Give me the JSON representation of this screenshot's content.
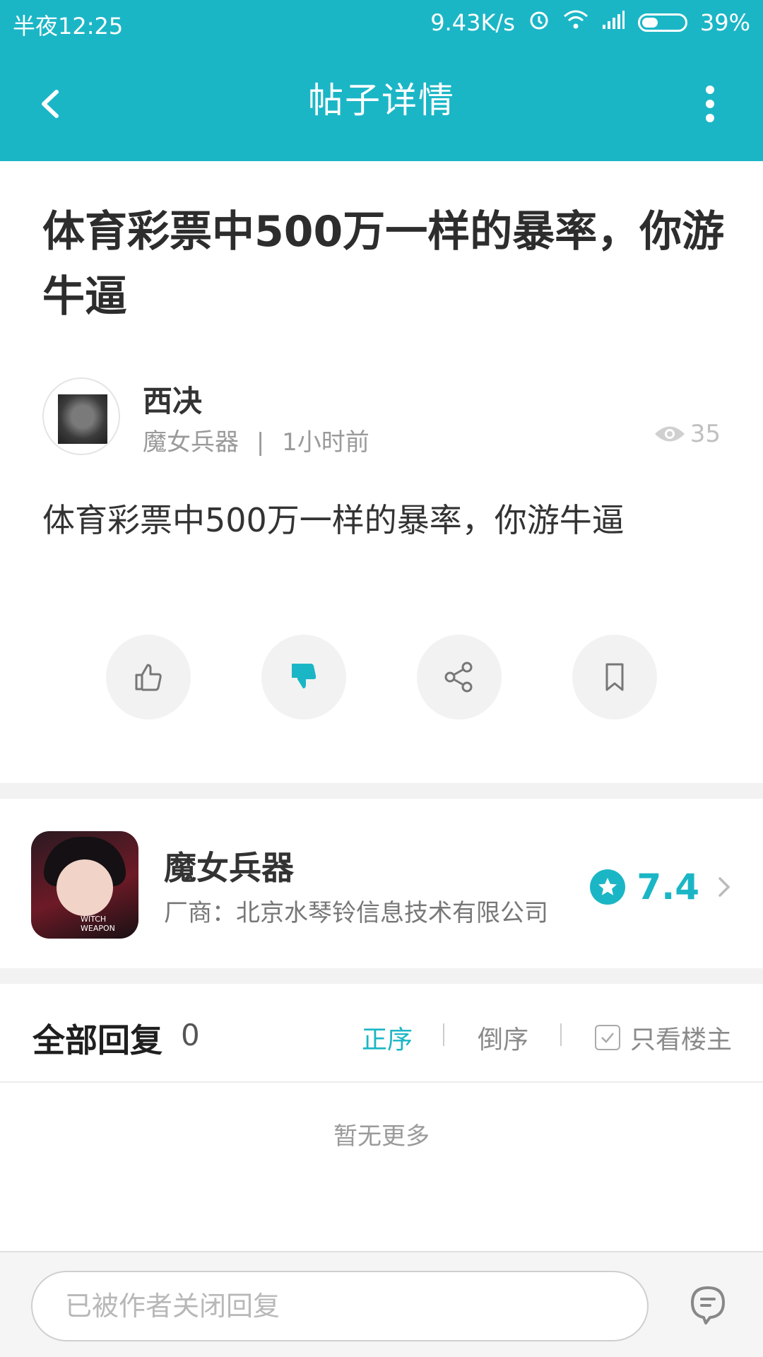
{
  "status_bar": {
    "time": "半夜12:25",
    "net_speed": "9.43K/s",
    "battery_percent": "39%",
    "battery_level": 0.39
  },
  "app_bar": {
    "title": "帖子详情"
  },
  "post": {
    "title": "体育彩票中500万一样的暴率，你游牛逼",
    "author_name": "西决",
    "game_tag": "魔女兵器",
    "separator": "|",
    "time_ago": "1小时前",
    "views": "35",
    "body": "体育彩票中500万一样的暴率，你游牛逼"
  },
  "actions": [
    "thumbs-up-icon",
    "thumbs-down-icon",
    "share-icon",
    "bookmark-icon"
  ],
  "game": {
    "name": "魔女兵器",
    "vendor": "厂商：北京水琴铃信息技术有限公司",
    "rating": "7.4",
    "icon_caption": "WITCH WEAPON"
  },
  "replies": {
    "title": "全部回复",
    "count": "0",
    "sort_asc": "正序",
    "sort_desc": "倒序",
    "only_owner": "只看楼主",
    "empty_text": "暂无更多"
  },
  "bottom_bar": {
    "placeholder": "已被作者关闭回复"
  },
  "colors": {
    "accent": "#1bb6c6",
    "thumbs_down_active": "#1bb6c6"
  }
}
